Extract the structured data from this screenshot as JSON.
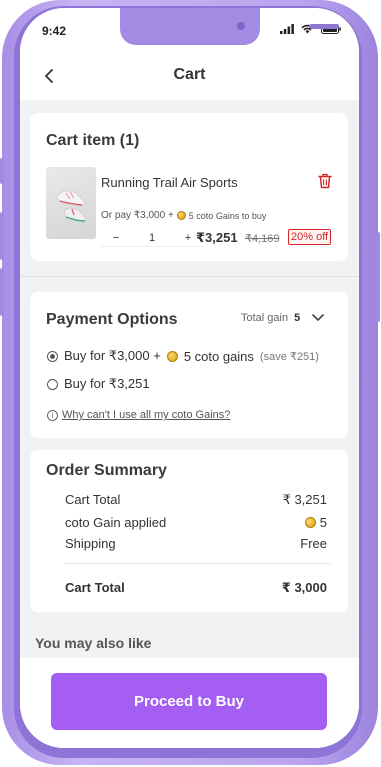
{
  "status": {
    "time": "9:42"
  },
  "header": {
    "title": "Cart"
  },
  "cart": {
    "title": "Cart item (1)",
    "item": {
      "name": "Running Trail Air Sports",
      "or_pay_prefix": "Or pay ₹3,000 +",
      "or_pay_suffix": "5 coto Gains to buy",
      "qty_minus": "−",
      "qty": "1",
      "qty_plus": "+",
      "price": "₹3,251",
      "mrp": "₹4,169",
      "discount": "20% off"
    }
  },
  "payment": {
    "title": "Payment Options",
    "total_gain_label": "Total gain",
    "total_gain_value": "5",
    "option1_prefix": "Buy for ₹3,000 +",
    "option1_coins": "5 coto gains",
    "option1_note": "(save ₹251)",
    "option1_selected": true,
    "option2": "Buy for ₹3,251",
    "why_link": "Why can't I use all my coto Gains?"
  },
  "summary": {
    "title": "Order Summary",
    "rows": [
      {
        "label": "Cart Total",
        "value": "₹ 3,251"
      },
      {
        "label": "coto Gain applied",
        "value": "5"
      },
      {
        "label": "Shipping",
        "value": "Free"
      }
    ],
    "total_label": "Cart Total",
    "total_value": "₹ 3,000"
  },
  "also_like": "You may also like",
  "cta": {
    "label": "Proceed to Buy"
  },
  "colors": {
    "accent": "#a45ef2",
    "frame": "#b9a4ee",
    "danger": "#d32626",
    "coin": "#e0a620"
  }
}
